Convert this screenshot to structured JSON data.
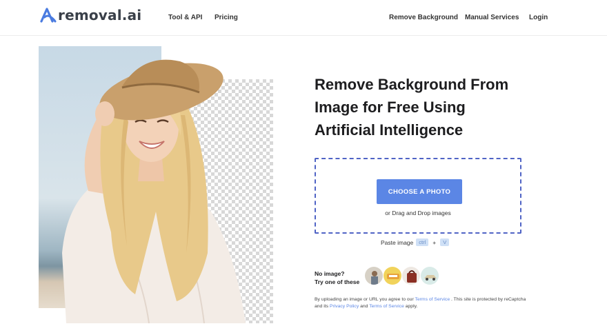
{
  "header": {
    "logo_text": "removal.ai",
    "nav_left": [
      "Tool & API",
      "Pricing"
    ],
    "nav_right": [
      "Remove Background",
      "Manual Services",
      "Login"
    ]
  },
  "hero": {
    "headline": [
      "Remove Background From",
      "Image for Free Using",
      "Artificial Intelligence"
    ]
  },
  "upload": {
    "button_label": "CHOOSE A PHOTO",
    "drop_text": "or Drag and Drop images",
    "paste_label": "Paste image",
    "paste_key1": "ctrl",
    "paste_plus": "+",
    "paste_key2": "V"
  },
  "samples": {
    "label_line1": "No image?",
    "label_line2": "Try one of these"
  },
  "legal": {
    "part1": "By uploading an image or URL you agree to our ",
    "tos_link": "Terms of Service",
    "part2": " . This site is protected by reCaptcha and its ",
    "privacy_link": "Privacy Policy",
    "part3": " and ",
    "tos_link2": "Terms of Service",
    "part4": " apply."
  },
  "colors": {
    "accent": "#5b86e5",
    "dropzone_border": "#4f63c5",
    "logo_mark": "#4a7be0"
  }
}
